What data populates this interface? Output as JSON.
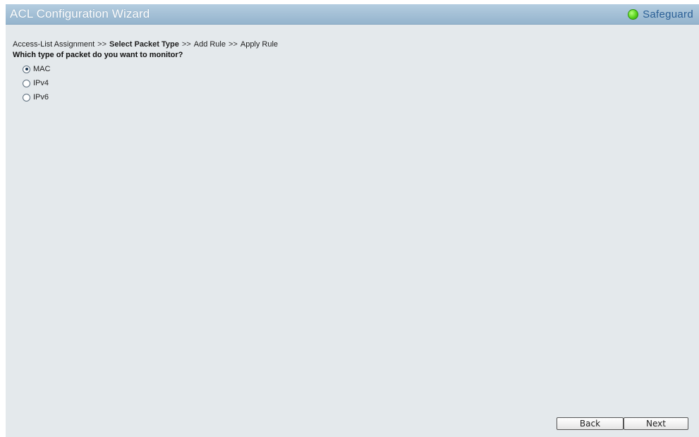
{
  "window": {
    "title": "ACL Configuration Wizard",
    "safeguard_label": "Safeguard",
    "status_color": "#59d31c"
  },
  "breadcrumb": {
    "steps": [
      "Access-List Assignment",
      "Select Packet Type",
      "Add Rule",
      "Apply Rule"
    ],
    "separator": ">>",
    "current_step": "Select Packet Type"
  },
  "question": "Which type of packet do you want to monitor?",
  "packet_types": [
    {
      "label": "MAC",
      "selected": true
    },
    {
      "label": "IPv4",
      "selected": false
    },
    {
      "label": "IPv6",
      "selected": false
    }
  ],
  "buttons": {
    "back_label": "Back",
    "next_label": "Next"
  }
}
